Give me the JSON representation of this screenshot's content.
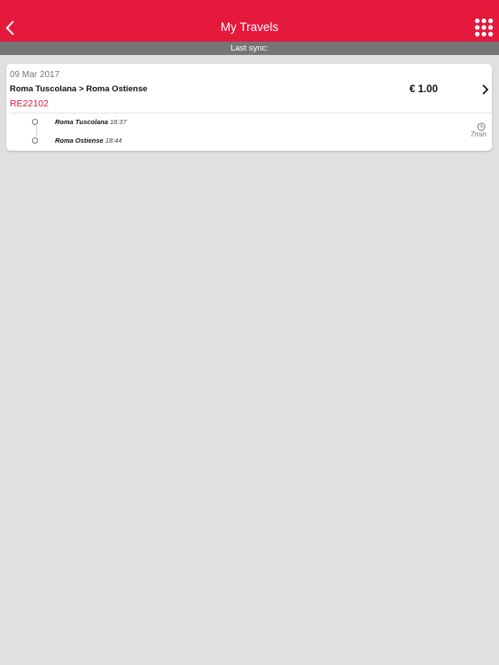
{
  "header": {
    "title": "My Travels",
    "back_icon": "chevron-left-icon",
    "menu_icon": "grid-menu-icon",
    "color": "#e5193c"
  },
  "sync": {
    "label": "Last sync:"
  },
  "travels": [
    {
      "date": "09 Mar 2017",
      "route": "Roma Tuscolana > Roma Ostiense",
      "code": "RE22102",
      "price": "€ 1.00",
      "duration": "7min",
      "stops": [
        {
          "name": "Roma Tuscolana",
          "time": "18:37"
        },
        {
          "name": "Roma Ostiense",
          "time": "18:44"
        }
      ]
    }
  ]
}
